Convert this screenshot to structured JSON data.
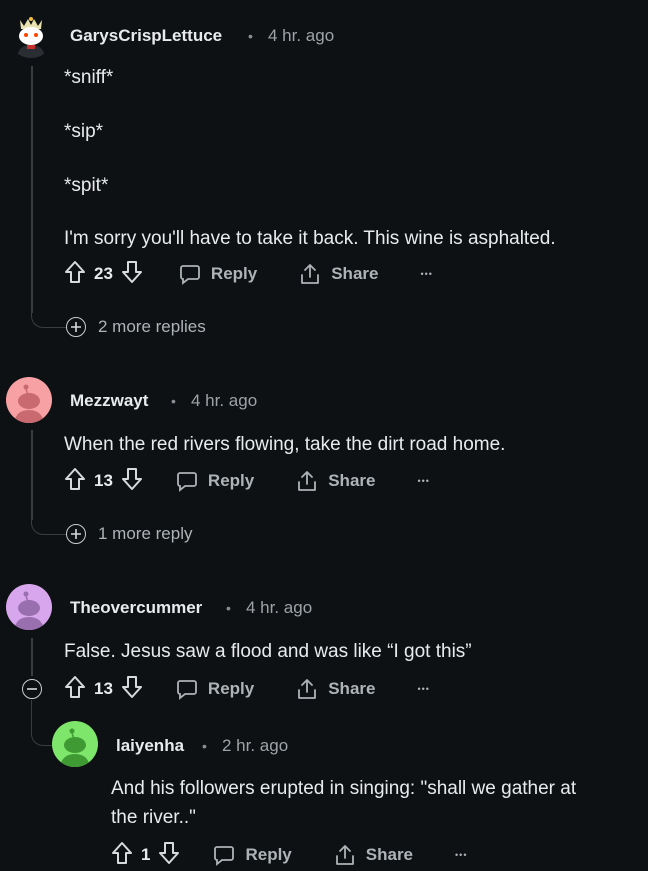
{
  "comments": [
    {
      "username": "GarysCrispLettuce",
      "time": "4 hr. ago",
      "lines": [
        "*sniff*",
        "*sip*",
        "*spit*",
        "I'm sorry you'll have to take it back. This wine is asphalted."
      ],
      "votes": "23",
      "more_replies": "2 more replies",
      "avatar_color": "#ffffff"
    },
    {
      "username": "Mezzwayt",
      "time": "4 hr. ago",
      "lines": [
        "When the red rivers flowing, take the dirt road home."
      ],
      "votes": "13",
      "more_replies": "1 more reply",
      "avatar_color": "#f7a1a5"
    },
    {
      "username": "Theovercummer",
      "time": "4 hr. ago",
      "lines": [
        "False. Jesus saw a flood and was like “I got this”"
      ],
      "votes": "13",
      "avatar_color": "#d7a6ec"
    },
    {
      "username": "laiyenha",
      "time": "2 hr. ago",
      "lines": [
        "And his followers erupted in singing: \"shall we gather at",
        "the river..\""
      ],
      "votes": "1",
      "avatar_color": "#7ee66a"
    }
  ],
  "labels": {
    "reply": "Reply",
    "share": "Share",
    "separator": "•",
    "more": "•••"
  }
}
